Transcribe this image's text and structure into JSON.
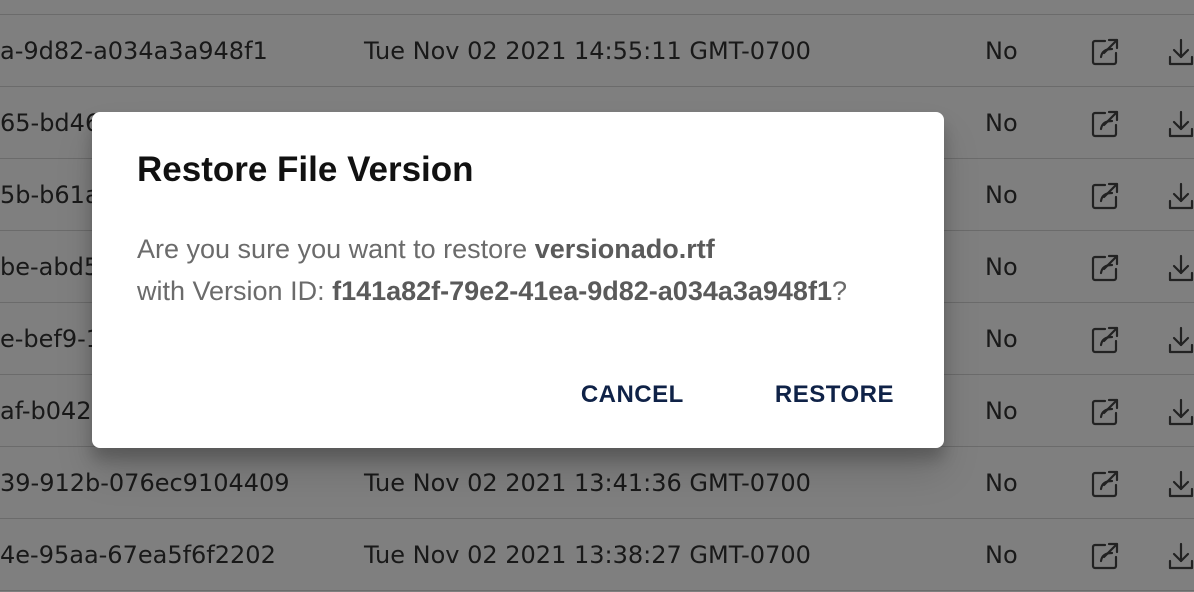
{
  "table": {
    "rows": [
      {
        "version_id": "a-9d82-a034a3a948f1",
        "date": "Tue Nov 02 2021 14:55:11 GMT-0700",
        "flag": "No"
      },
      {
        "version_id": "65-bd46-",
        "date": "",
        "flag": "No"
      },
      {
        "version_id": "5b-b61a-",
        "date": "",
        "flag": "No"
      },
      {
        "version_id": "be-abd5-",
        "date": "",
        "flag": "No"
      },
      {
        "version_id": "e-bef9-1",
        "date": "",
        "flag": "No"
      },
      {
        "version_id": "af-b042-",
        "date": "",
        "flag": "No"
      },
      {
        "version_id": "39-912b-076ec9104409",
        "date": "Tue Nov 02 2021 13:41:36 GMT-0700",
        "flag": "No"
      },
      {
        "version_id": "4e-95aa-67ea5f6f2202",
        "date": "Tue Nov 02 2021 13:38:27 GMT-0700",
        "flag": "No"
      }
    ],
    "action_icons": [
      "share-icon",
      "download-icon"
    ]
  },
  "dialog": {
    "title": "Restore File Version",
    "line1_prefix": "Are you sure you want to restore ",
    "file_name": "versionado.rtf",
    "line2_prefix": "with Version ID: ",
    "version_id": "f141a82f-79e2-41ea-9d82-a034a3a948f1",
    "line2_suffix": "?",
    "cancel_label": "CANCEL",
    "restore_label": "RESTORE"
  },
  "colors": {
    "overlay": "rgba(0,0,0,0.5)",
    "button_text": "#0f2247"
  }
}
